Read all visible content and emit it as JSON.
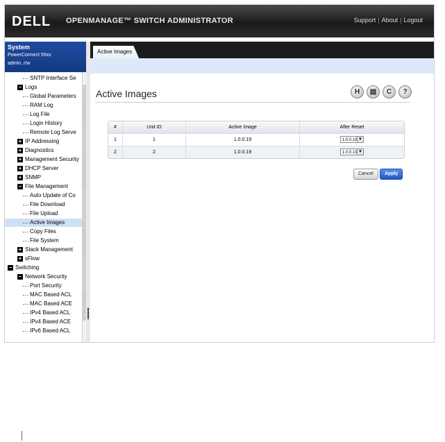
{
  "header": {
    "logo": "DELL",
    "product": "OPENMANAGE™ SWITCH ADMINISTRATOR",
    "links": [
      "Support",
      "About",
      "Logout"
    ]
  },
  "system": {
    "title": "System",
    "model": "PowerConnect 55xx",
    "user": "admin, r/w"
  },
  "nav": {
    "items": [
      {
        "label": "SNTP Interface Se",
        "level": 3,
        "icon": "none"
      },
      {
        "label": "Logs",
        "level": 2,
        "icon": "minus"
      },
      {
        "label": "Global Parameters",
        "level": 3,
        "icon": "none"
      },
      {
        "label": "RAM Log",
        "level": 3,
        "icon": "none"
      },
      {
        "label": "Log File",
        "level": 3,
        "icon": "none"
      },
      {
        "label": "Login History",
        "level": 3,
        "icon": "none"
      },
      {
        "label": "Remote Log Serve",
        "level": 3,
        "icon": "none"
      },
      {
        "label": "IP Addressing",
        "level": 2,
        "icon": "plus"
      },
      {
        "label": "Diagnostics",
        "level": 2,
        "icon": "plus"
      },
      {
        "label": "Management Security",
        "level": 2,
        "icon": "plus"
      },
      {
        "label": "DHCP Server",
        "level": 2,
        "icon": "plus"
      },
      {
        "label": "SNMP",
        "level": 2,
        "icon": "plus"
      },
      {
        "label": "File Management",
        "level": 2,
        "icon": "minus"
      },
      {
        "label": "Auto Update of Co",
        "level": 3,
        "icon": "none"
      },
      {
        "label": "File Download",
        "level": 3,
        "icon": "none"
      },
      {
        "label": "File Upload",
        "level": 3,
        "icon": "none"
      },
      {
        "label": "Active Images",
        "level": 3,
        "icon": "none",
        "selected": true
      },
      {
        "label": "Copy Files",
        "level": 3,
        "icon": "none"
      },
      {
        "label": "File System",
        "level": 3,
        "icon": "none"
      },
      {
        "label": "Stack Management",
        "level": 2,
        "icon": "plus"
      },
      {
        "label": "sFlow",
        "level": 2,
        "icon": "plus"
      },
      {
        "label": "Switching",
        "level": 1,
        "icon": "minus"
      },
      {
        "label": "Network Security",
        "level": 2,
        "icon": "minus"
      },
      {
        "label": "Port Security",
        "level": 3,
        "icon": "none"
      },
      {
        "label": "MAC Based ACL",
        "level": 3,
        "icon": "none"
      },
      {
        "label": "MAC Based ACE",
        "level": 3,
        "icon": "none"
      },
      {
        "label": "IPv4 Based ACL",
        "level": 3,
        "icon": "none"
      },
      {
        "label": "IPv4 Based ACE",
        "level": 3,
        "icon": "none"
      },
      {
        "label": "IPv6 Based ACL",
        "level": 3,
        "icon": "none"
      }
    ]
  },
  "tab": {
    "label": "Active Images"
  },
  "page": {
    "title": "Active Images"
  },
  "toolbar": {
    "icons": [
      "save-icon",
      "print-icon",
      "refresh-icon",
      "help-icon"
    ],
    "glyphs": [
      "H",
      "▤",
      "C",
      "?"
    ]
  },
  "table": {
    "headers": [
      "#",
      "Unit ID",
      "Active Image",
      "After Reset"
    ],
    "rows": [
      {
        "num": "1",
        "unit": "1",
        "active": "1.0.0.19",
        "after": "1.0.0.19"
      },
      {
        "num": "2",
        "unit": "2",
        "active": "1.0.0.19",
        "after": "1.0.0.19"
      }
    ]
  },
  "buttons": {
    "cancel": "Cancel",
    "apply": "Apply"
  }
}
